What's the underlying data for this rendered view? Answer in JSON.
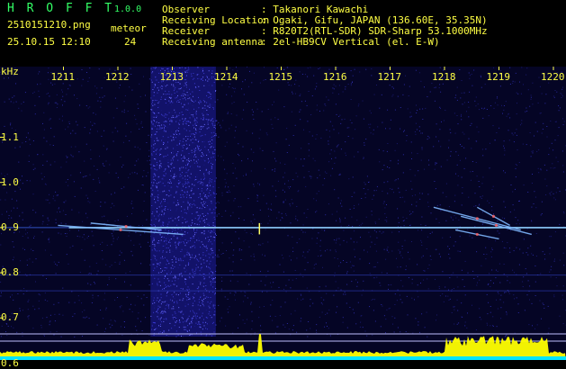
{
  "app": {
    "name": "H R O F F T",
    "version": "1.0.0"
  },
  "file": {
    "name": "2510151210.png",
    "timestamp": "25.10.15 12:10"
  },
  "counter": {
    "label": "meteor",
    "value": "24"
  },
  "info": [
    {
      "key": "Observer",
      "value": ": Takanori Kawachi"
    },
    {
      "key": "Receiving Location",
      "value": ": Ogaki, Gifu, JAPAN (136.60E, 35.35N)"
    },
    {
      "key": "Receiver",
      "value": ": R820T2(RTL-SDR) SDR-Sharp 53.1000MHz"
    },
    {
      "key": "Receiving antenna",
      "value": ": 2el-HB9CV Vertical (el. E-W)"
    }
  ],
  "colors": {
    "background": "#000000",
    "plot_bg": "#050525",
    "label": "#ffff44",
    "title": "#33ff66",
    "text": "#ffffff",
    "carrier": "#8fd0ff",
    "baseline": "#00e5ff",
    "burst": "#ffff00"
  },
  "chart_data": {
    "type": "heatmap",
    "x_axis": {
      "unit": "",
      "min": 1210,
      "max": 1220,
      "ticks": [
        "1211",
        "1212",
        "1213",
        "1214",
        "1215",
        "1216",
        "1217",
        "1218",
        "1219",
        "1220"
      ]
    },
    "y_axis": {
      "unit": "kHz",
      "min": 0.6,
      "max": 1.15,
      "ticks": [
        "1.1",
        "1.0",
        "0.9",
        "0.8",
        "0.7",
        "0.6"
      ]
    },
    "carrier_khz": 0.9,
    "noise_band": {
      "from_x": 1212.6,
      "to_x": 1213.8
    },
    "echoes": [
      {
        "x": [
          1210.9,
          1213.2
        ],
        "y": [
          0.905,
          0.885
        ]
      },
      {
        "x": [
          1211.5,
          1212.8
        ],
        "y": [
          0.91,
          0.895
        ]
      },
      {
        "x": [
          1217.8,
          1219.4
        ],
        "y": [
          0.945,
          0.895
        ]
      },
      {
        "x": [
          1218.3,
          1219.6
        ],
        "y": [
          0.925,
          0.885
        ]
      },
      {
        "x": [
          1218.6,
          1219.2
        ],
        "y": [
          0.945,
          0.905
        ]
      },
      {
        "x": [
          1218.2,
          1219.0
        ],
        "y": [
          0.895,
          0.875
        ]
      }
    ],
    "spikes_x": [
      1214.6
    ]
  }
}
